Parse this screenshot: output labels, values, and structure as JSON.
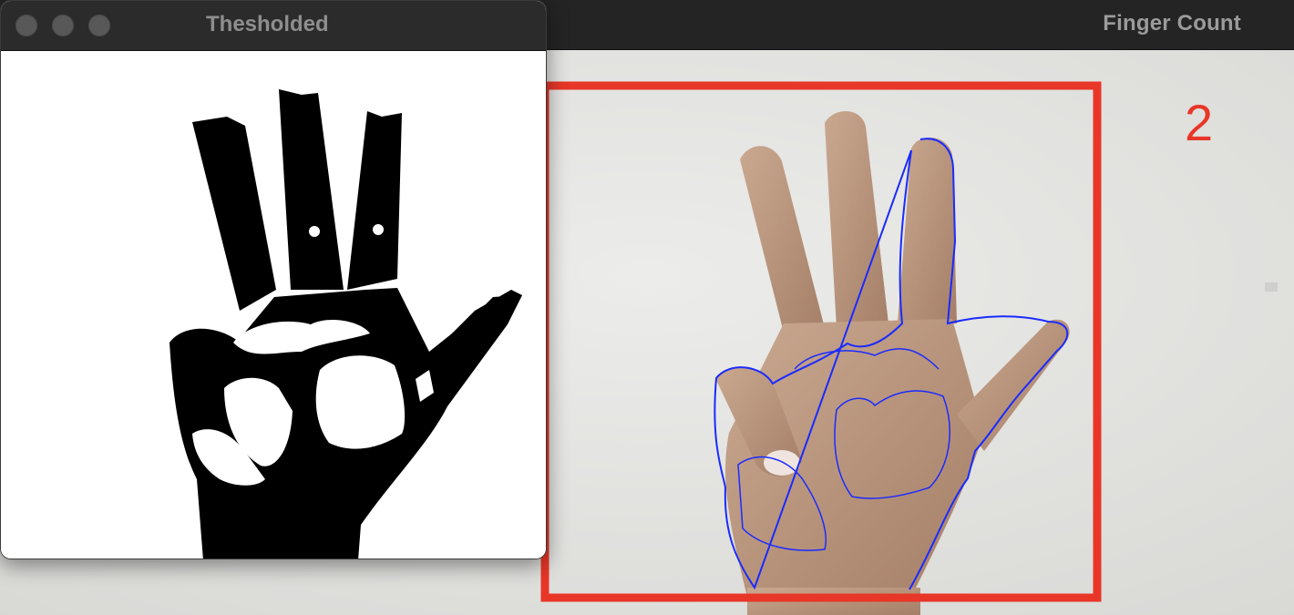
{
  "windows": {
    "back": {
      "title": "Finger Count",
      "finger_count": "2"
    },
    "front": {
      "title": "Thesholded"
    }
  },
  "colors": {
    "bounding_box": "#e83628",
    "contour": "#1a2bff",
    "skin": "#c09a82",
    "threshold_fg": "#000000",
    "threshold_bg": "#ffffff"
  },
  "icons": [
    "close-button-icon",
    "minimize-button-icon",
    "zoom-button-icon"
  ]
}
